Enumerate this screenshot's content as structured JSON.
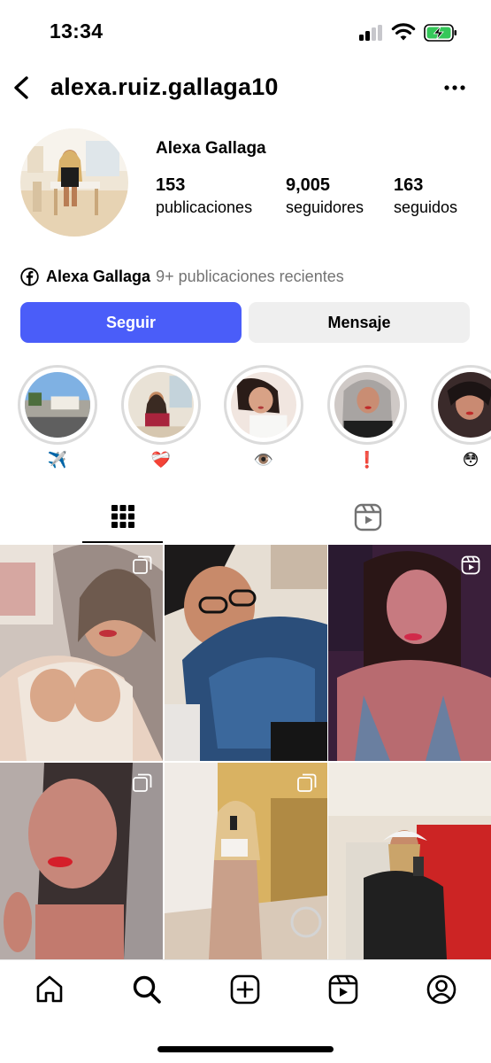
{
  "status_bar": {
    "time": "13:34"
  },
  "header": {
    "username": "alexa.ruiz.gallaga10"
  },
  "profile": {
    "display_name": "Alexa Gallaga",
    "stats": {
      "posts_count": "153",
      "posts_label": "publicaciones",
      "followers_count": "9,005",
      "followers_label": "seguidores",
      "following_count": "163",
      "following_label": "seguidos"
    },
    "facebook": {
      "name": "Alexa Gallaga",
      "recent": "9+ publicaciones recientes"
    }
  },
  "actions": {
    "follow_label": "Seguir",
    "message_label": "Mensaje"
  },
  "highlights": [
    {
      "label": "✈️"
    },
    {
      "label": "❤️‍🩹"
    },
    {
      "label": "👁️"
    },
    {
      "label": "❗"
    },
    {
      "label": "😳"
    }
  ],
  "tabs": {
    "active": "grid",
    "items": [
      "grid-icon",
      "reels-icon"
    ]
  },
  "bottom_nav": {
    "items": [
      "home-icon",
      "search-icon",
      "create-icon",
      "reels-icon",
      "profile-icon"
    ]
  },
  "colors": {
    "accent": "#4a5df9",
    "secondary_button": "#efefef",
    "muted_text": "#737373"
  }
}
